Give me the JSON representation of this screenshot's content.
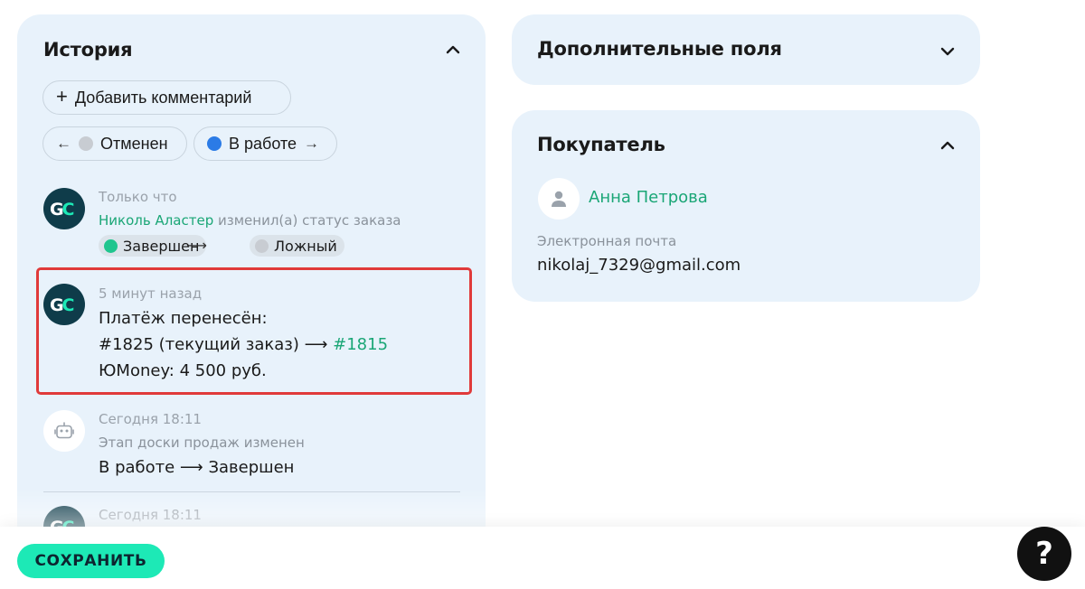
{
  "history": {
    "title": "История",
    "add_comment_label": "Добавить комментарий",
    "status_prev_label": "Отменен",
    "status_next_label": "В работе",
    "entries": [
      {
        "avatar": "GC",
        "time": "Только что",
        "author": "Николь Аластер",
        "action": " изменил(а) статус заказа",
        "from_status": "Завершен",
        "to_status": "Ложный"
      },
      {
        "avatar": "GC",
        "time": "5 минут назад",
        "line1": "Платёж перенесён:",
        "line2_text": "#1825 (текущий заказ) ⟶ ",
        "line2_link": "#1815",
        "line3": "ЮMoney: 4 500 руб."
      },
      {
        "avatar_icon": "robot-icon",
        "time": "Сегодня 18:11",
        "text": "Этап доски продаж изменен",
        "change": "В работе ⟶ Завершен"
      },
      {
        "avatar": "GC",
        "time": "Сегодня 18:11"
      }
    ]
  },
  "extra_fields": {
    "title": "Дополнительные поля"
  },
  "buyer": {
    "title": "Покупатель",
    "name": "Анна Петрова",
    "email_label": "Электронная почта",
    "email": "nikolaj_7329@gmail.com"
  },
  "footer": {
    "save_label": "СОХРАНИТЬ",
    "help_label": "?"
  },
  "colors": {
    "card_bg": "#e8f2fb",
    "accent_green": "#1aa676",
    "save_bg": "#1de9b6",
    "highlight_border": "#e03a3a",
    "status_blue": "#2b7be6",
    "status_green": "#1fc58e",
    "status_grey": "#c8ccd2"
  }
}
